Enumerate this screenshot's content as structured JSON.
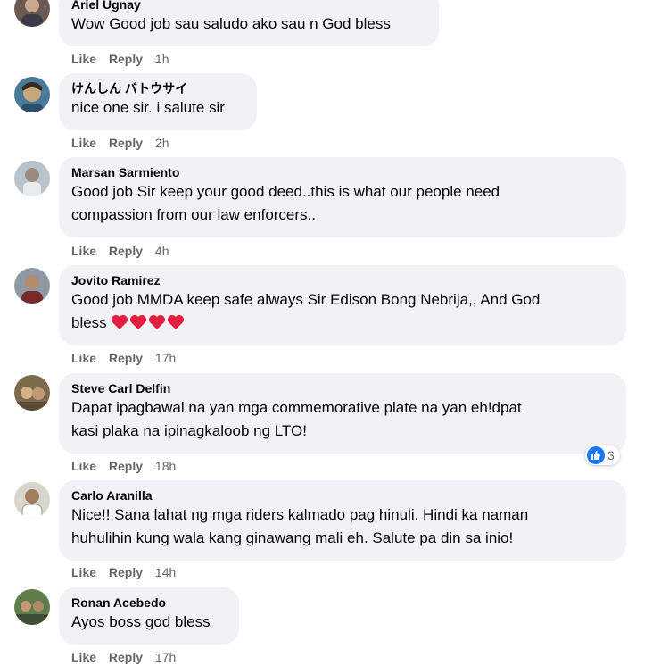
{
  "actions": {
    "like": "Like",
    "reply": "Reply"
  },
  "colors": {
    "bubble": "#f0f2f5",
    "text": "#050505",
    "meta": "#65676b",
    "like_blue": "#1877f2",
    "heart": "#e41e3f"
  },
  "comments": [
    {
      "author": "Ariel Ugnay",
      "lines": [
        "Wow Good job sau saludo ako sau n God bless"
      ],
      "time": "1h",
      "avatar": "avatar-photo"
    },
    {
      "author": "けんしん バトウサイ",
      "lines": [
        "nice one sir. i salute sir"
      ],
      "time": "2h",
      "avatar": "avatar-photo"
    },
    {
      "author": "Marsan Sarmiento",
      "lines": [
        "Good job Sir keep your good deed..this is what our people need",
        "compassion from our law enforcers.."
      ],
      "time": "4h",
      "avatar": "avatar-photo"
    },
    {
      "author": "Jovito Ramirez",
      "lines": [
        "Good job MMDA keep safe always Sir Edison Bong Nebrija,, And God",
        "bless"
      ],
      "emoji": "heart-icon x4",
      "time": "17h",
      "avatar": "avatar-photo"
    },
    {
      "author": "Steve Carl Delfin",
      "lines": [
        "Dapat ipagbawal na yan mga commemorative plate na yan eh!dpat",
        "kasi plaka na ipinagkaloob ng LTO!"
      ],
      "time": "18h",
      "avatar": "avatar-photo",
      "reaction": {
        "icon": "like-icon",
        "count": "3"
      }
    },
    {
      "author": "Carlo Aranilla",
      "lines": [
        "Nice!! Sana lahat ng mga riders kalmado pag hinuli. Hindi ka naman",
        "huhulihin kung wala kang ginawang mali eh. Salute pa din sa inio!"
      ],
      "time": "14h",
      "avatar": "avatar-photo"
    },
    {
      "author": "Ronan Acebedo",
      "lines": [
        "Ayos boss god bless"
      ],
      "time": "17h",
      "avatar": "avatar-photo"
    }
  ]
}
